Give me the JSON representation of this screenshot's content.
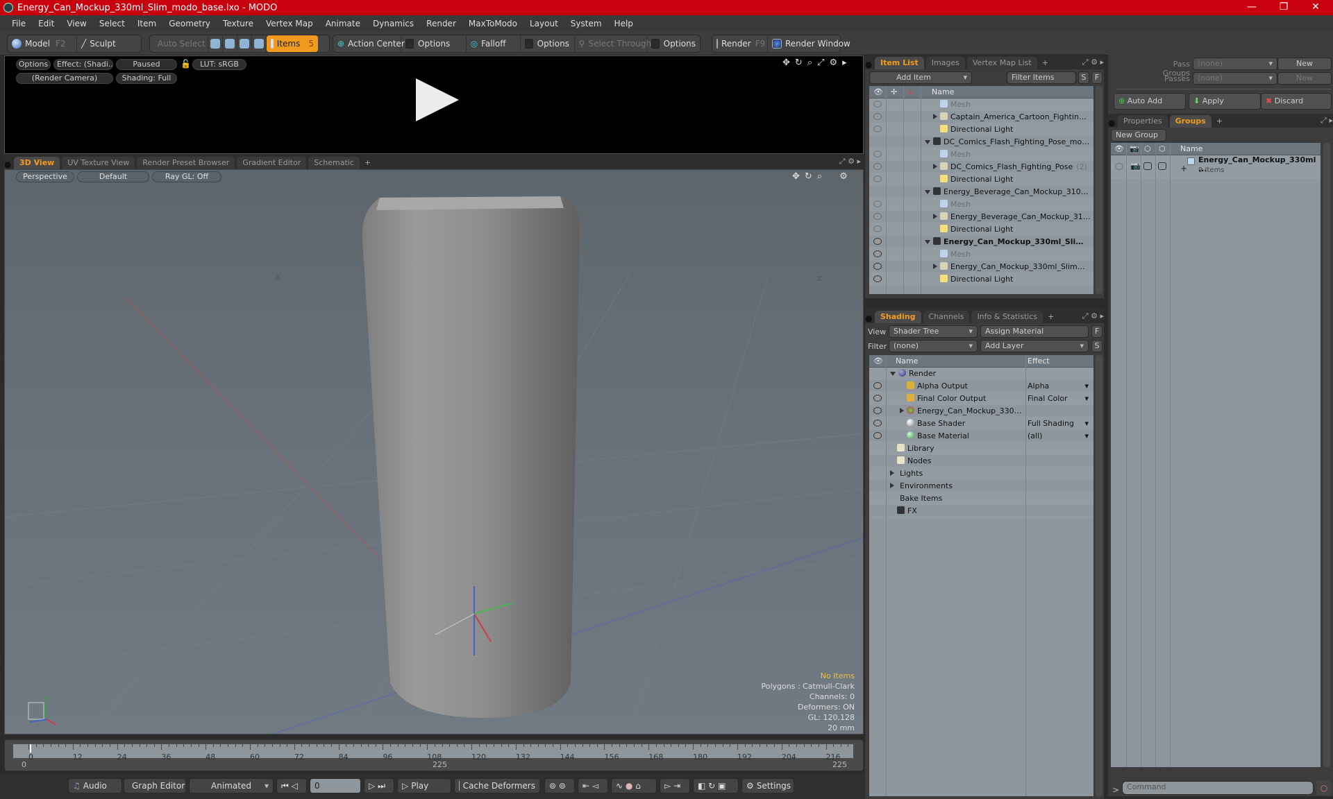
{
  "window": {
    "title": "Energy_Can_Mockup_330ml_Slim_modo_base.lxo - MODO",
    "controls": [
      "minimize",
      "maximize",
      "close"
    ]
  },
  "menu": [
    "File",
    "Edit",
    "View",
    "Select",
    "Item",
    "Geometry",
    "Texture",
    "Vertex Map",
    "Animate",
    "Dynamics",
    "Render",
    "MaxToModo",
    "Layout",
    "System",
    "Help"
  ],
  "toolbar": {
    "model": "Model",
    "model_key": "F2",
    "sculpt": "Sculpt",
    "auto_select": "Auto Select",
    "items": "Items",
    "items_key": "5",
    "action_center": "Action Center",
    "options1": "Options",
    "falloff": "Falloff",
    "options2": "Options",
    "select_through": "Select Through",
    "options3": "Options",
    "render": "Render",
    "render_key": "F9",
    "render_window": "Render Window"
  },
  "render_view": {
    "options": "Options",
    "effect": "Effect: (Shadi...",
    "paused": "Paused",
    "lut": "LUT: sRGB",
    "camera": "(Render Camera)",
    "shading": "Shading: Full"
  },
  "viewport_tabs": [
    "3D View",
    "UV Texture View",
    "Render Preset Browser",
    "Gradient Editor",
    "Schematic"
  ],
  "viewport": {
    "projection": "Perspective",
    "style": "Default",
    "raygl": "Ray GL: Off",
    "axis_labels": {
      "x": "X",
      "y": "Y",
      "z": "Z"
    },
    "overlay": {
      "selection": "No Items",
      "polygons": "Polygons : Catmull-Clark",
      "channels": "Channels: 0",
      "deformers": "Deformers: ON",
      "gl": "GL: 120,128",
      "scale": "20 mm"
    }
  },
  "timeline": {
    "ticks": [
      "0",
      "12",
      "24",
      "36",
      "48",
      "60",
      "72",
      "84",
      "96",
      "108",
      "120",
      "132",
      "144",
      "156",
      "168",
      "180",
      "192",
      "204",
      "216"
    ],
    "range_start": "0",
    "range_mid": "225",
    "range_end": "225"
  },
  "bottom": {
    "audio": "Audio",
    "graph_editor": "Graph Editor",
    "animated": "Animated",
    "frame": "0",
    "play": "Play",
    "cache_deformers": "Cache Deformers",
    "settings": "Settings"
  },
  "item_list": {
    "tabs": [
      "Item List",
      "Images",
      "Vertex Map List"
    ],
    "add_item": "Add Item",
    "filter_placeholder": "Filter Items",
    "s": "S",
    "f": "F",
    "col_name": "Name",
    "rows": [
      {
        "label": "Mesh",
        "indent": 2,
        "type": "mesh",
        "eye": "dim"
      },
      {
        "label": "Captain_America_Cartoon_Fighting_P...",
        "indent": 2,
        "type": "group",
        "expand": "r",
        "eye": "dim"
      },
      {
        "label": "Directional Light",
        "indent": 2,
        "type": "light",
        "eye": "dim"
      },
      {
        "label": "DC_Comics_Flash_Fighting_Pose_modo_...",
        "indent": 1,
        "type": "scene",
        "expand": "d",
        "eye": "none"
      },
      {
        "label": "Mesh",
        "indent": 2,
        "type": "mesh",
        "eye": "dim"
      },
      {
        "label": "DC_Comics_Flash_Fighting_Pose",
        "count": "(2)",
        "indent": 2,
        "type": "group",
        "expand": "r",
        "eye": "dim"
      },
      {
        "label": "Directional Light",
        "indent": 2,
        "type": "light",
        "eye": "dim"
      },
      {
        "label": "Energy_Beverage_Can_Mockup_310ml_...",
        "indent": 1,
        "type": "scene",
        "expand": "d",
        "eye": "none"
      },
      {
        "label": "Mesh",
        "indent": 2,
        "type": "mesh",
        "eye": "dim"
      },
      {
        "label": "Energy_Beverage_Can_Mockup_310 ...",
        "indent": 2,
        "type": "group",
        "expand": "r",
        "eye": "dim"
      },
      {
        "label": "Directional Light",
        "indent": 2,
        "type": "light",
        "eye": "dim"
      },
      {
        "label": "Energy_Can_Mockup_330ml_Slim ...",
        "indent": 1,
        "type": "scene",
        "expand": "d",
        "eye": "on",
        "bold": true
      },
      {
        "label": "Mesh",
        "indent": 2,
        "type": "mesh",
        "eye": "on"
      },
      {
        "label": "Energy_Can_Mockup_330ml_Slim",
        "count": "(2)",
        "indent": 2,
        "type": "group",
        "expand": "r",
        "eye": "on"
      },
      {
        "label": "Directional Light",
        "indent": 2,
        "type": "light",
        "eye": "on"
      }
    ]
  },
  "shading": {
    "tabs": [
      "Shading",
      "Channels",
      "Info & Statistics"
    ],
    "view_label": "View",
    "view_value": "Shader Tree",
    "assign_material": "Assign Material",
    "f": "F",
    "filter_label": "Filter",
    "filter_value": "(none)",
    "add_layer": "Add Layer",
    "s": "S",
    "col_name": "Name",
    "col_effect": "Effect",
    "rows": [
      {
        "label": "Render",
        "indent": 0,
        "icon": "render-sphere",
        "expand": "d",
        "effect": "",
        "eye": false
      },
      {
        "label": "Alpha Output",
        "indent": 1,
        "icon": "output",
        "effect": "Alpha",
        "eye": true
      },
      {
        "label": "Final Color Output",
        "indent": 1,
        "icon": "output",
        "effect": "Final Color",
        "eye": true
      },
      {
        "label": "Energy_Can_Mockup_330 ...",
        "indent": 1,
        "icon": "material-group",
        "expand": "r",
        "effect": "",
        "eye": true
      },
      {
        "label": "Base Shader",
        "indent": 1,
        "icon": "shader",
        "effect": "Full Shading",
        "eye": true
      },
      {
        "label": "Base Material",
        "indent": 1,
        "icon": "material",
        "effect": "(all)",
        "eye": true
      },
      {
        "label": "Library",
        "indent": 0,
        "icon": "folder",
        "effect": "",
        "eye": false
      },
      {
        "label": "Nodes",
        "indent": 0,
        "icon": "folder",
        "effect": "",
        "eye": false
      },
      {
        "label": "Lights",
        "indent": 0,
        "icon": "",
        "expand": "r",
        "effect": "",
        "eye": false
      },
      {
        "label": "Environments",
        "indent": 0,
        "icon": "",
        "expand": "r",
        "effect": "",
        "eye": false
      },
      {
        "label": "Bake Items",
        "indent": 0,
        "icon": "",
        "effect": "",
        "eye": false
      },
      {
        "label": "FX",
        "indent": 0,
        "icon": "clapper",
        "effect": "",
        "eye": false
      }
    ]
  },
  "passes": {
    "pass_groups_label": "Pass Groups",
    "pass_groups_value": "(none)",
    "passes_label": "Passes",
    "passes_value": "(none)",
    "new": "New",
    "auto_add": "Auto Add",
    "apply": "Apply",
    "discard": "Discard"
  },
  "groups": {
    "tabs": [
      "Properties",
      "Groups"
    ],
    "new_group": "New Group",
    "col_name": "Name",
    "item_name": "Energy_Can_Mockup_330ml ...",
    "item_count": "9 Items"
  },
  "command": {
    "placeholder": "Command",
    "prompt": ">"
  },
  "colors": {
    "accent": "#f39c1f",
    "titlebar": "#c9000d",
    "list_bg": "#8e979e"
  }
}
